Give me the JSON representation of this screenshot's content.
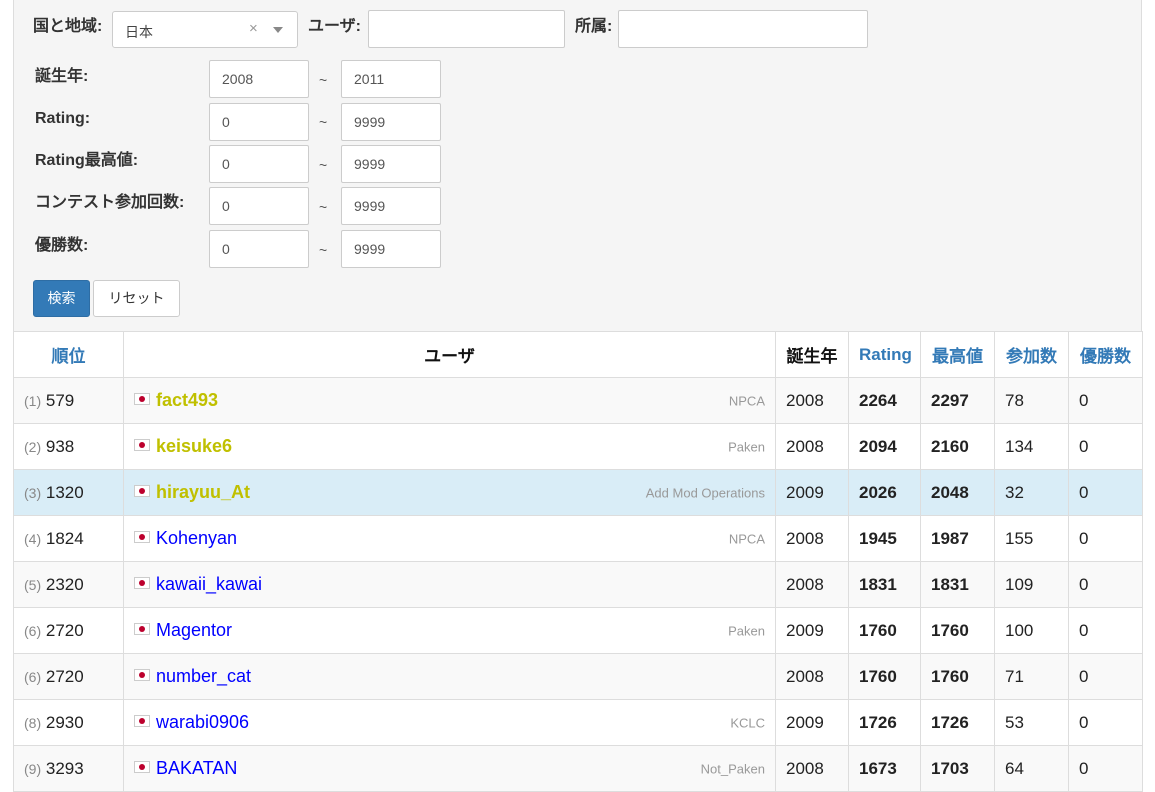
{
  "filters": {
    "country_label": "国と地域:",
    "country_value": "日本",
    "clear_glyph": "×",
    "user_label": "ユーザ:",
    "user_value": "",
    "affiliation_label": "所属:",
    "affiliation_value": "",
    "range_separator": "~",
    "ranges": [
      {
        "label": "誕生年:",
        "min": "2008",
        "max": "2011"
      },
      {
        "label": "Rating:",
        "min": "0",
        "max": "9999"
      },
      {
        "label": "Rating最高値:",
        "min": "0",
        "max": "9999"
      },
      {
        "label": "コンテスト参加回数:",
        "min": "0",
        "max": "9999"
      },
      {
        "label": "優勝数:",
        "min": "0",
        "max": "9999"
      }
    ],
    "search_button": "検索",
    "reset_button": "リセット"
  },
  "table": {
    "headers": [
      "順位",
      "ユーザ",
      "誕生年",
      "Rating",
      "最高値",
      "参加数",
      "優勝数"
    ],
    "rows": [
      {
        "rank_sub": "(1)",
        "rank": "579",
        "user": "fact493",
        "user_color": "#c0c000",
        "affiliation": "NPCA",
        "birth": "2008",
        "rating": "2264",
        "highest": "2297",
        "matches": "78",
        "wins": "0"
      },
      {
        "rank_sub": "(2)",
        "rank": "938",
        "user": "keisuke6",
        "user_color": "#c0c000",
        "affiliation": "Paken",
        "birth": "2008",
        "rating": "2094",
        "highest": "2160",
        "matches": "134",
        "wins": "0"
      },
      {
        "rank_sub": "(3)",
        "rank": "1320",
        "user": "hirayuu_At",
        "user_color": "#c0c000",
        "affiliation": "Add Mod Operations",
        "birth": "2009",
        "rating": "2026",
        "highest": "2048",
        "matches": "32",
        "wins": "0"
      },
      {
        "rank_sub": "(4)",
        "rank": "1824",
        "user": "Kohenyan",
        "user_color": "#0000ff",
        "affiliation": "NPCA",
        "birth": "2008",
        "rating": "1945",
        "highest": "1987",
        "matches": "155",
        "wins": "0"
      },
      {
        "rank_sub": "(5)",
        "rank": "2320",
        "user": "kawaii_kawai",
        "user_color": "#0000ff",
        "affiliation": "",
        "birth": "2008",
        "rating": "1831",
        "highest": "1831",
        "matches": "109",
        "wins": "0"
      },
      {
        "rank_sub": "(6)",
        "rank": "2720",
        "user": "Magentor",
        "user_color": "#0000ff",
        "affiliation": "Paken",
        "birth": "2009",
        "rating": "1760",
        "highest": "1760",
        "matches": "100",
        "wins": "0"
      },
      {
        "rank_sub": "(6)",
        "rank": "2720",
        "user": "number_cat",
        "user_color": "#0000ff",
        "affiliation": "",
        "birth": "2008",
        "rating": "1760",
        "highest": "1760",
        "matches": "71",
        "wins": "0"
      },
      {
        "rank_sub": "(8)",
        "rank": "2930",
        "user": "warabi0906",
        "user_color": "#0000ff",
        "affiliation": "KCLC",
        "birth": "2009",
        "rating": "1726",
        "highest": "1726",
        "matches": "53",
        "wins": "0"
      },
      {
        "rank_sub": "(9)",
        "rank": "3293",
        "user": "BAKATAN",
        "user_color": "#0000ff",
        "affiliation": "Not_Paken",
        "birth": "2008",
        "rating": "1673",
        "highest": "1703",
        "matches": "64",
        "wins": "0"
      }
    ]
  },
  "colors": {
    "link": "#337ab7",
    "primary_button": "#337ab7",
    "highlight_row": "#d9edf7",
    "user_yellow": "#c0c000",
    "user_blue": "#0000ff"
  }
}
